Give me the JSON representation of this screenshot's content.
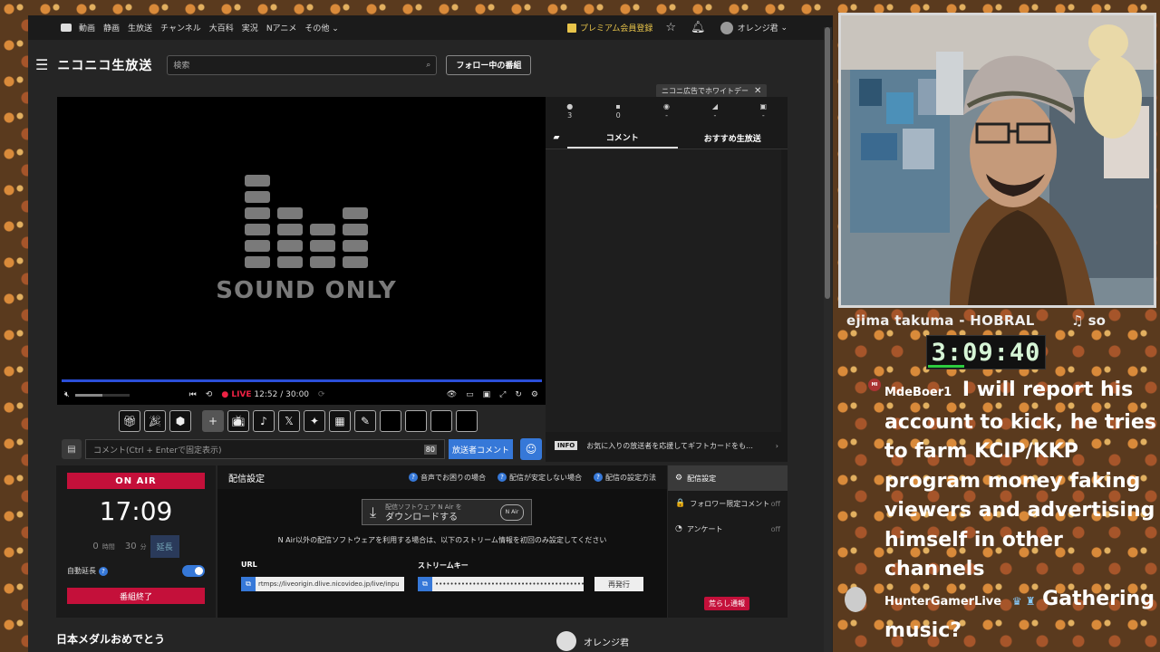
{
  "topnav": {
    "items": [
      "動画",
      "静画",
      "生放送",
      "チャンネル",
      "大百科",
      "実況",
      "Nアニメ",
      "その他"
    ],
    "premium": "プレミアム会員登録",
    "username": "オレンジ君"
  },
  "header": {
    "logo": "ニコニコ生放送",
    "search_placeholder": "検索",
    "follow_button": "フォロー中の番組"
  },
  "ad_banner": "ニコニ広告でホワイトデー",
  "player": {
    "sound_only": "SOUND ONLY",
    "live_label": "LIVE",
    "time": "12:52 / 30:00"
  },
  "comment_input": {
    "placeholder": "コメント(Ctrl + Enterで固定表示)",
    "count": "80",
    "send_label": "放送者コメント"
  },
  "stats": [
    "3",
    "0",
    "-",
    "-",
    "-"
  ],
  "comment_tabs": [
    "コメント",
    "おすすめ生放送"
  ],
  "info_bar": {
    "tag": "INFO",
    "text": "お気に入りの放送者を応援してギフトカードをも…"
  },
  "onair": {
    "label": "ON AIR",
    "clock": "17:09",
    "hours": "0",
    "hours_unit": "時間",
    "minutes": "30",
    "minutes_unit": "分",
    "extend": "延長",
    "auto_extend": "自動延長",
    "end_button": "番組終了"
  },
  "settings": {
    "title": "配信設定",
    "links": [
      "音声でお困りの場合",
      "配信が安定しない場合",
      "配信の設定方法"
    ],
    "nair_small": "配信ソフトウェア N Air を",
    "nair_big": "ダウンロードする",
    "note": "N Air以外の配信ソフトウェアを利用する場合は、以下のストリーム情報を初回のみ設定してください",
    "url_label": "URL",
    "url_value": "rtmps://liveorigin.dlive.nicovideo.jp/live/inpu",
    "key_label": "ストリームキー",
    "key_value": "••••••••••••••••••••••••••••••••••••••••••••••",
    "reissue": "再発行"
  },
  "side_menu": [
    {
      "icon": "⚙",
      "label": "配信設定",
      "off": ""
    },
    {
      "icon": "🔒",
      "label": "フォロワー限定コメント",
      "off": "off"
    },
    {
      "icon": "◔",
      "label": "アンケート",
      "off": "off"
    }
  ],
  "report_button": "荒らし通報",
  "bottom": {
    "title": "日本メダルおめでとう",
    "user": "オレンジ君"
  },
  "overlay": {
    "streamer": "ejima takuma - HOBRAL",
    "music": "♫ so",
    "timer": "3:09:40",
    "messages": [
      {
        "user": "MdeBoer1",
        "text": "I will report his account to kick, he tries to farm KCIP/KKP program money faking viewers and advertising himself in other channels"
      },
      {
        "user": "HunterGamerLive",
        "text": "Gathering music?"
      }
    ]
  },
  "colors": {
    "accent": "#3678d8",
    "onair": "#c4103a",
    "timer_text": "#d6f5d6"
  }
}
